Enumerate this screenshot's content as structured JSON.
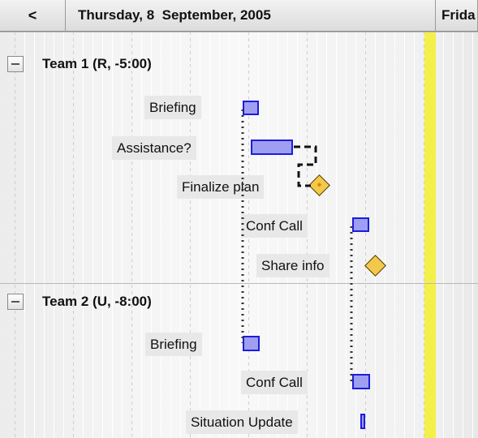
{
  "header": {
    "prev_button": "<",
    "current_day": "Thursday, 8  September, 2005",
    "next_day": "Frida"
  },
  "teams": [
    {
      "label": "Team 1 (R, -5:00)",
      "tasks": [
        {
          "label": "Briefing",
          "kind": "task"
        },
        {
          "label": "Assistance?",
          "kind": "task"
        },
        {
          "label": "Finalize plan",
          "kind": "milestone"
        },
        {
          "label": "Conf Call",
          "kind": "task"
        },
        {
          "label": "Share info",
          "kind": "milestone"
        }
      ]
    },
    {
      "label": "Team 2 (U, -8:00)",
      "tasks": [
        {
          "label": "Briefing",
          "kind": "task"
        },
        {
          "label": "Conf Call",
          "kind": "task"
        },
        {
          "label": "Situation Update",
          "kind": "task"
        }
      ]
    }
  ],
  "colors": {
    "task_fill": "#9f9ff2",
    "task_border": "#1c1ce0",
    "milestone_fill": "#f4c84a",
    "today_marker": "#f4f04a",
    "header_bg": "#e0e0e0"
  },
  "icons": {
    "prev": "chevron-left-icon",
    "collapse": "minus-icon",
    "milestone": "diamond-icon"
  }
}
